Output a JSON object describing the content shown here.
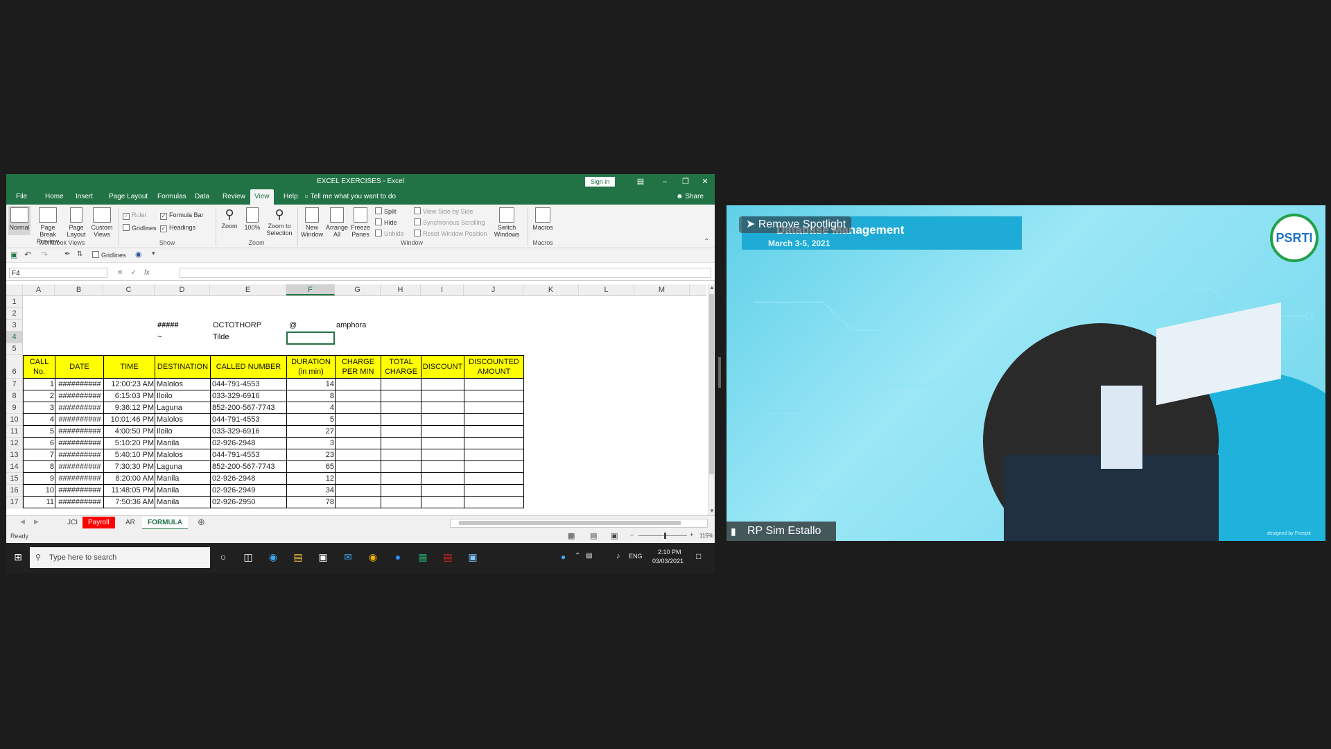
{
  "excel": {
    "title": "EXCEL EXERCISES - Excel",
    "sign_in": "Sign in",
    "tabs": [
      "File",
      "Home",
      "Insert",
      "Page Layout",
      "Formulas",
      "Data",
      "Review",
      "View",
      "Help"
    ],
    "tell_me": "Tell me what you want to do",
    "share": "Share",
    "ribbon": {
      "workbook_views": [
        "Normal",
        "Page Break Preview",
        "Page Layout",
        "Custom Views"
      ],
      "workbook_views_label": "Workbook Views",
      "show_items": [
        "Ruler",
        "Formula Bar",
        "Gridlines",
        "Headings"
      ],
      "show_label": "Show",
      "zoom_items": [
        "Zoom",
        "100%",
        "Zoom to Selection"
      ],
      "zoom_label": "Zoom",
      "window_items": [
        "New Window",
        "Arrange All",
        "Freeze Panes"
      ],
      "window_small": [
        "Split",
        "Hide",
        "Unhide"
      ],
      "window_dim": [
        "View Side by Side",
        "Synchronous Scrolling",
        "Reset Window Position"
      ],
      "switch_windows": "Switch Windows",
      "window_label": "Window",
      "macros": "Macros",
      "macros_label": "Macros"
    },
    "qat_gridlines": "Gridlines",
    "name_box": "F4",
    "fx": "fx",
    "columns": [
      "A",
      "B",
      "C",
      "D",
      "E",
      "F",
      "G",
      "H",
      "I",
      "J",
      "K",
      "L",
      "M"
    ],
    "rows": [
      "1",
      "2",
      "3",
      "4",
      "5",
      "6",
      "7",
      "8",
      "9",
      "10",
      "11",
      "12",
      "13",
      "14",
      "15",
      "16",
      "17"
    ],
    "cells": {
      "d3": "#####",
      "e3": "OCTOTHORP",
      "f3": "@",
      "g3": "amphora",
      "d4": "~",
      "e4": "Tilde"
    },
    "table_headers": [
      "CALL No.",
      "DATE",
      "TIME",
      "DESTINATION",
      "CALLED NUMBER",
      "DURATION (in min)",
      "CHARGE PER MIN",
      "TOTAL CHARGE",
      "DISCOUNT",
      "DISCOUNTED AMOUNT"
    ],
    "table_rows": [
      [
        "1",
        "##########",
        "12:00:23 AM",
        "Malolos",
        "044-791-4553",
        "14"
      ],
      [
        "2",
        "##########",
        "6:15:03 PM",
        "Iloilo",
        "033-329-6916",
        "8"
      ],
      [
        "3",
        "##########",
        "9:36:12 PM",
        "Laguna",
        "852-200-567-7743",
        "4"
      ],
      [
        "4",
        "##########",
        "10:01:46 PM",
        "Malolos",
        "044-791-4553",
        "5"
      ],
      [
        "5",
        "##########",
        "4:00:50 PM",
        "Iloilo",
        "033-329-6916",
        "27"
      ],
      [
        "6",
        "##########",
        "5:10:20 PM",
        "Manila",
        "02-926-2948",
        "3"
      ],
      [
        "7",
        "##########",
        "5:40:10 PM",
        "Malolos",
        "044-791-4553",
        "23"
      ],
      [
        "8",
        "##########",
        "7:30:30 PM",
        "Laguna",
        "852-200-567-7743",
        "65"
      ],
      [
        "9",
        "##########",
        "8:20:00 AM",
        "Manila",
        "02-926-2948",
        "12"
      ],
      [
        "10",
        "##########",
        "11:48:05 PM",
        "Manila",
        "02-926-2949",
        "34"
      ],
      [
        "11",
        "##########",
        "7:50:36 AM",
        "Manila",
        "02-926-2950",
        "78"
      ]
    ],
    "sheets": [
      "JCI",
      "Payroll",
      "AR",
      "FORMULA"
    ],
    "status": "Ready",
    "zoom_pct": "115%",
    "taskbar_search": "Type here to search",
    "taskbar_lang": "ENG",
    "clock_time": "2:10 PM",
    "clock_date": "03/03/2021"
  },
  "video": {
    "banner_title": "Database Management",
    "banner_date": "March 3-5, 2021",
    "spotlight": "Remove Spotlight",
    "participant": "RP Sim Estallo",
    "logo_text": "PSRTI",
    "credit": "designed by Freepik"
  },
  "colors": {
    "excel_green": "#217346",
    "header_yellow": "#ffff00",
    "sheet_red": "#ff0000",
    "video_cyan": "#6fd6ec"
  }
}
